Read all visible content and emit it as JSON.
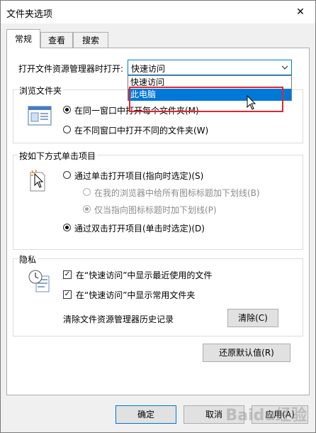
{
  "window": {
    "title": "文件夹选项",
    "close_glyph": "✕"
  },
  "tabs": [
    {
      "label": "常规",
      "active": true
    },
    {
      "label": "查看",
      "active": false
    },
    {
      "label": "搜索",
      "active": false
    }
  ],
  "general": {
    "open_explorer_label": "打开文件资源管理器时打开:",
    "open_explorer_value": "快速访问",
    "dropdown_options": [
      "快速访问",
      "此电脑"
    ],
    "dropdown_highlighted": "此电脑",
    "browse_group": {
      "title": "浏览文件夹",
      "option_same_window": "在同一窗口中打开每个文件夹(M)",
      "option_new_window": "在不同窗口中打开不同的文件夹(W)",
      "selected": "same_window"
    },
    "click_group": {
      "title": "按如下方式单击项目",
      "single_click": "通过单击打开项目(指向时选定)(S)",
      "underline_consistent": "在我的浏览器中给所有图标标题加下划线(B)",
      "underline_point": "仅当指向图标标题时加下划线(P)",
      "double_click": "通过双击打开项目(单击时选定)(D)",
      "selected": "double_click"
    },
    "privacy_group": {
      "title": "隐私",
      "show_recent_files": "在“快速访问”中显示最近使用的文件",
      "show_frequent_folders": "在“快速访问”中显示常用文件夹",
      "recent_checked": true,
      "frequent_checked": true,
      "clear_history_label": "清除文件资源管理器历史记录",
      "clear_button": "清除(C)"
    },
    "restore_defaults": "还原默认值(R)"
  },
  "footer": {
    "ok": "确定",
    "cancel": "取消",
    "apply": "应用(A)"
  },
  "watermark": "Baidu经验",
  "icons": {
    "browse": "folder-window-icon",
    "click": "pointer-click-icon",
    "privacy": "clock-document-icon",
    "dropdown": "chevron-down-icon"
  },
  "colors": {
    "accent": "#0078d7",
    "highlight_box": "#e0262c"
  }
}
